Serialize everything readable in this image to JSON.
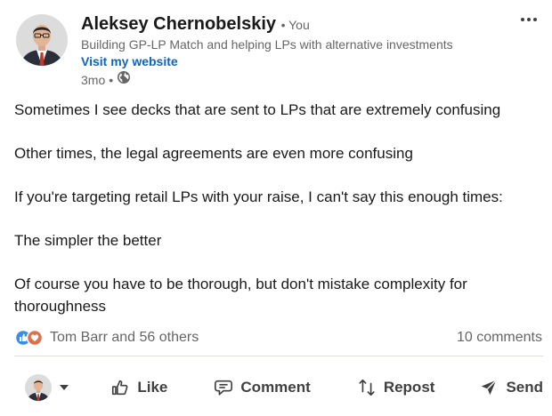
{
  "post": {
    "author_name": "Aleksey Chernobelskiy",
    "connection": "• You",
    "headline": "Building GP-LP Match and helping LPs with alternative investments",
    "website_link": "Visit my website",
    "time_ago": "3mo",
    "time_separator": "•",
    "visibility_icon": "globe-icon",
    "body": [
      "Sometimes I see decks that are sent to LPs that are extremely confusing",
      "Other times, the legal agreements are even more confusing",
      "If you're targeting retail LPs with your raise, I can't say this enough times:",
      "The simpler the better",
      "Of course you have to be thorough, but don't mistake complexity for thoroughness"
    ]
  },
  "social": {
    "reaction_icons": [
      "like-icon",
      "love-icon"
    ],
    "reactors_text": "Tom Barr and 56 others",
    "comments_text": "10 comments"
  },
  "actions": {
    "like": "Like",
    "comment": "Comment",
    "repost": "Repost",
    "send": "Send"
  },
  "colors": {
    "link_blue": "#0a66c2",
    "like_blue": "#378fe9",
    "love_red": "#df704d",
    "text_secondary": "#666666"
  }
}
